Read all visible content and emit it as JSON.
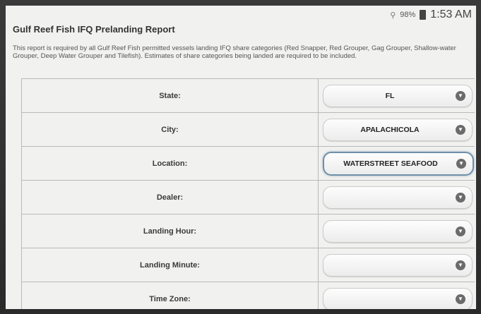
{
  "status": {
    "battery": "98%",
    "time": "1:53 AM"
  },
  "page": {
    "title": "Gulf Reef Fish IFQ Prelanding Report",
    "description": "This report is required by all Gulf Reef Fish permitted vessels landing IFQ share categories (Red Snapper, Red Grouper, Gag Grouper, Shallow-water Grouper, Deep Water Grouper and Tilefish). Estimates of share categories being landed are required to be included."
  },
  "form": {
    "rows": [
      {
        "label": "State:",
        "value": "FL"
      },
      {
        "label": "City:",
        "value": "APALACHICOLA"
      },
      {
        "label": "Location:",
        "value": "WATERSTREET SEAFOOD"
      },
      {
        "label": "Dealer:",
        "value": ""
      },
      {
        "label": "Landing Hour:",
        "value": ""
      },
      {
        "label": "Landing Minute:",
        "value": ""
      },
      {
        "label": "Time Zone:",
        "value": ""
      }
    ]
  },
  "icons": {
    "dropdown": "chevron-down-icon"
  }
}
